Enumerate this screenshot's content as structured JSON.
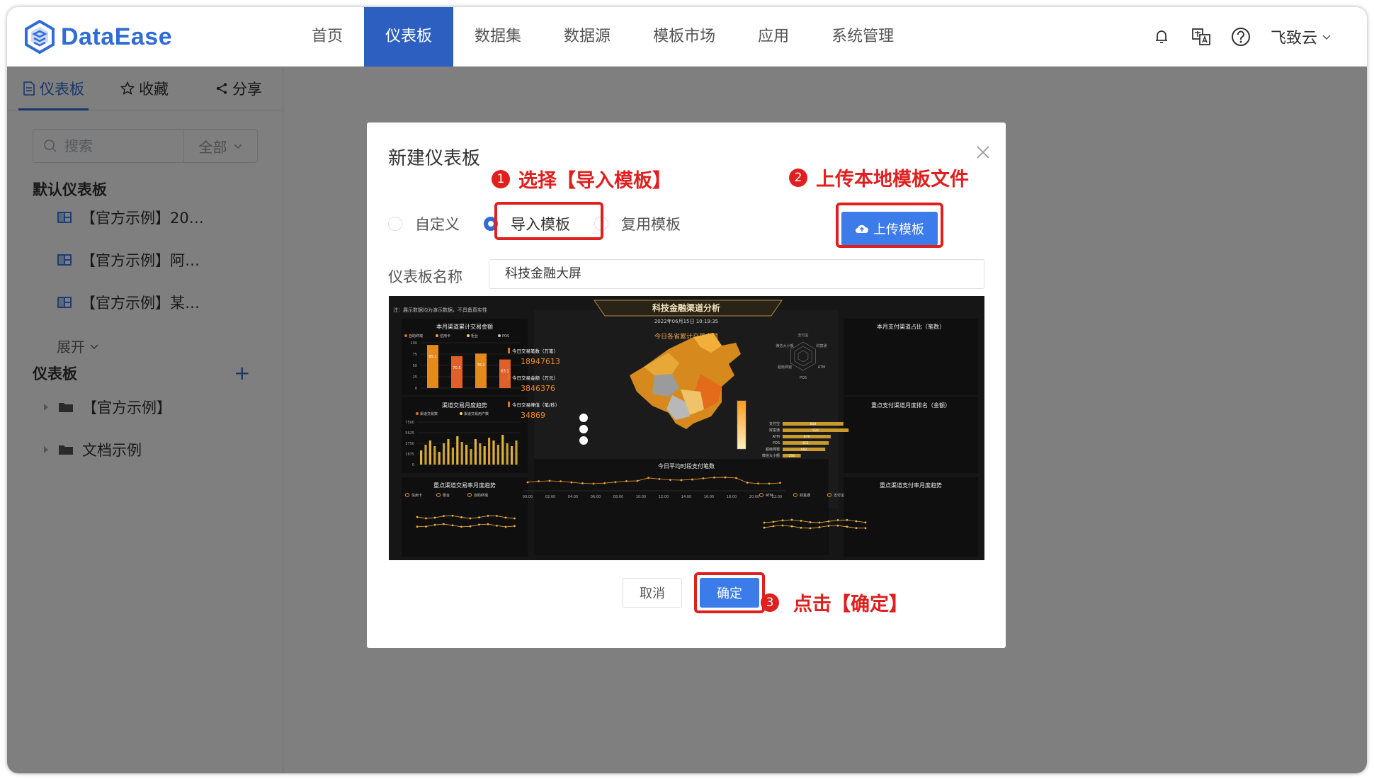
{
  "app": {
    "logo_text": "DataEase"
  },
  "nav": {
    "items": [
      {
        "label": "首页",
        "active": false
      },
      {
        "label": "仪表板",
        "active": true
      },
      {
        "label": "数据集",
        "active": false
      },
      {
        "label": "数据源",
        "active": false
      },
      {
        "label": "模板市场",
        "active": false
      },
      {
        "label": "应用",
        "active": false
      },
      {
        "label": "系统管理",
        "active": false
      }
    ],
    "user": "飞致云"
  },
  "sidebar": {
    "tabs": [
      {
        "label": "仪表板",
        "icon": "document-icon"
      },
      {
        "label": "收藏",
        "icon": "star-icon"
      },
      {
        "label": "分享",
        "icon": "share-icon"
      }
    ],
    "search_placeholder": "搜索",
    "filter_label": "全部",
    "default_section": "默认仪表板",
    "default_items": [
      "【官方示例】20…",
      "【官方示例】阿…",
      "【官方示例】某…"
    ],
    "expand_label": "展开",
    "dashboard_section": "仪表板",
    "folders": [
      "【官方示例】",
      "文档示例"
    ]
  },
  "dialog": {
    "title": "新建仪表板",
    "options": [
      {
        "label": "自定义",
        "checked": false
      },
      {
        "label": "导入模板",
        "checked": true
      },
      {
        "label": "复用模板",
        "checked": false
      }
    ],
    "upload_label": "上传模板",
    "name_label": "仪表板名称",
    "name_value": "科技金融大屏",
    "cancel_label": "取消",
    "confirm_label": "确定"
  },
  "annotations": {
    "step1_num": "1",
    "step1_text": "选择【导入模板】",
    "step2_num": "2",
    "step2_text": "上传本地模板文件",
    "step3_num": "3",
    "step3_text": "点击【确定】",
    "color": "#e01f1f"
  },
  "preview": {
    "note": "注：展示数据均为演示数据，不具备真实性",
    "title": "科技金融渠道分析",
    "datetime": "2022年06月15日 10:19:35",
    "map_title": "今日各省累计交易金额",
    "panel1_title": "本月渠道累计交易金额",
    "panel1_legend": [
      "自助终端",
      "信用卡",
      "柜台",
      "POS"
    ],
    "panel1_values": [
      95.1,
      70.5,
      76.2,
      63.1
    ],
    "panel1_yticks": [
      "100",
      "75",
      "50",
      "25",
      "0"
    ],
    "panel2_title": "渠道交易月度趋势",
    "panel2_legend": [
      "渠道交易数",
      "渠道交易用户数"
    ],
    "panel2_yticks": [
      "7500",
      "5625",
      "3750",
      "1875",
      "0"
    ],
    "panel3_title": "重点渠道交易率月度趋势",
    "panel3_legend": [
      "信用卡",
      "柜台",
      "自助终端"
    ],
    "kpi": [
      {
        "label": "今日交易笔数（万笔）",
        "value": "18947613"
      },
      {
        "label": "今日交易金额（万元）",
        "value": "3846376"
      },
      {
        "label": "今日交易峰值（笔/秒）",
        "value": "34869"
      }
    ],
    "bottom_title": "今日平均时段支付笔数",
    "bottom_xticks": [
      "00:00",
      "02:00",
      "04:00",
      "06:00",
      "08:00",
      "10:00",
      "12:00",
      "14:00",
      "16:00",
      "18:00",
      "20:00",
      "22:00"
    ],
    "right1_title": "本月支付渠道占比（笔数）",
    "right1_labels": [
      "支付宝",
      "财富通",
      "ATM",
      "POS",
      "超级网银",
      "微信大小额"
    ],
    "right2_title": "重点支付渠道月度排名（金额）",
    "right2_rows": [
      {
        "name": "支付宝",
        "value": 858
      },
      {
        "name": "财富通",
        "value": 932
      },
      {
        "name": "ATM",
        "value": 679
      },
      {
        "name": "POS",
        "value": 651
      },
      {
        "name": "超级网银",
        "value": 602
      },
      {
        "name": "微信大小额",
        "value": 256
      }
    ],
    "right3_title": "重点渠道支付率月度趋势",
    "right3_legend": [
      "ATM",
      "财富通",
      "支付宝"
    ]
  }
}
